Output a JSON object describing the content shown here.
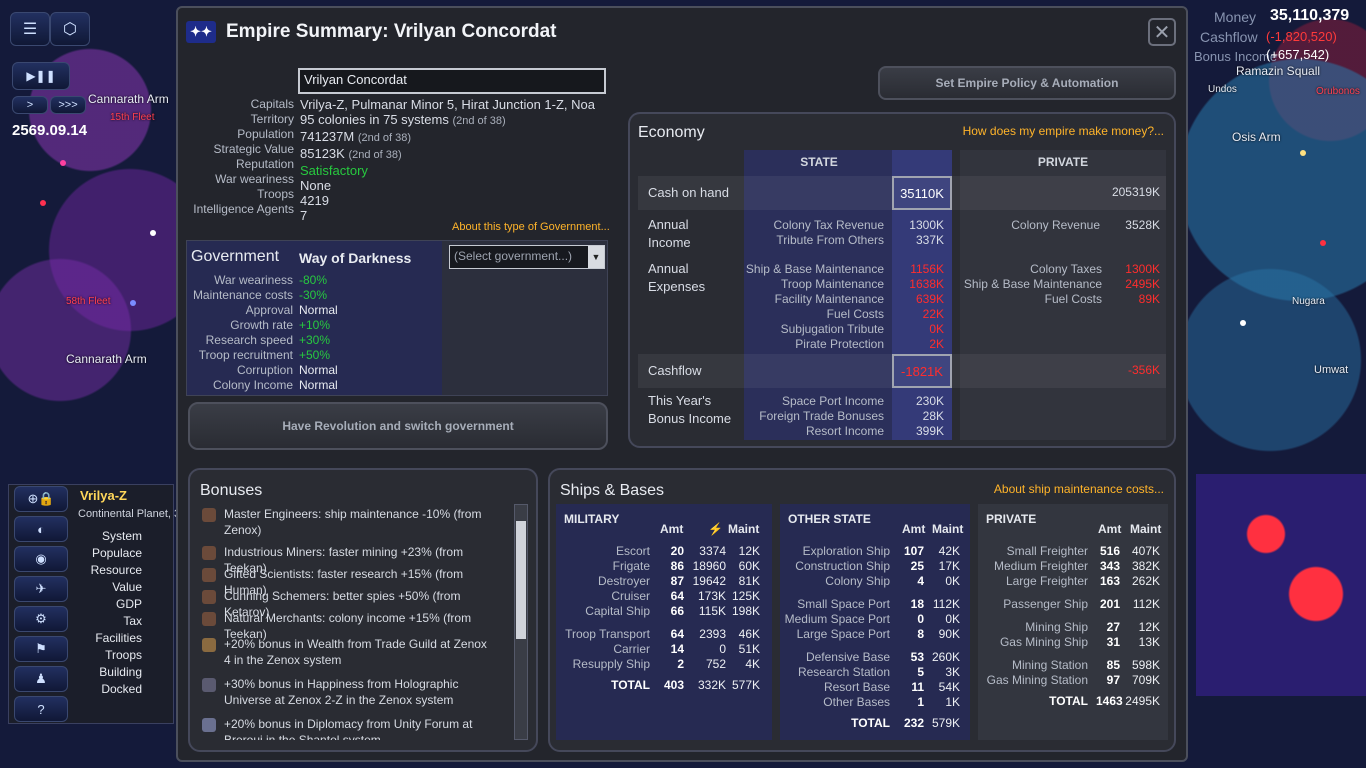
{
  "map": {
    "date": "2569.09.14",
    "labels_left": [
      "Cannarath Arm",
      "Cannarath Arm",
      "58th Fleet",
      "15th Fleet",
      "Vrilya-Z"
    ],
    "labels_right": [
      "Ramazin Squall",
      "Osis Arm",
      "Undos",
      "Umwat",
      "Nugara",
      "Orubonos"
    ],
    "money": {
      "label": "Money",
      "value": "35,110,379"
    },
    "cashflow": {
      "label": "Cashflow",
      "value": "(-1,820,520)"
    },
    "bonus_income": {
      "label": "Bonus Income",
      "value": "(+657,542)"
    }
  },
  "toolbar": {
    "play_label": "▶❚❚",
    "speed_slow": ">",
    "speed_fast": ">>>",
    "side_items": [
      "System",
      "Populace",
      "Resource",
      "Value",
      "GDP",
      "Tax",
      "Facilities",
      "Troops",
      "Building",
      "Docked"
    ],
    "selected_planet": "Vrilya-Z",
    "planet_desc": "Continental Planet, 3"
  },
  "window": {
    "title": "Empire Summary: Vrilyan Concordat",
    "close": "✕"
  },
  "empire": {
    "name_value": "Vrilyan Concordat",
    "rows": [
      {
        "label": "Capitals",
        "value": "Vrilya-Z, Pulmanar Minor 5, Hirat Junction 1-Z, Noa",
        "note": ""
      },
      {
        "label": "Territory",
        "value": "95 colonies in 75 systems",
        "note": "(2nd of 38)"
      },
      {
        "label": "Population",
        "value": "741237M",
        "note": "(2nd of 38)"
      },
      {
        "label": "Strategic Value",
        "value": "85123K",
        "note": "(2nd of 38)"
      },
      {
        "label": "Reputation",
        "value": "Satisfactory",
        "note": ""
      },
      {
        "label": "War weariness",
        "value": "None",
        "note": ""
      },
      {
        "label": "Troops",
        "value": "4219",
        "note": ""
      },
      {
        "label": "Intelligence Agents",
        "value": "7",
        "note": ""
      }
    ],
    "policy_button": "Set Empire Policy & Automation",
    "about_gov_link": "About this type of Government..."
  },
  "government": {
    "heading": "Government",
    "type": "Way of Darkness",
    "select_placeholder": "(Select government...)",
    "rows": [
      {
        "label": "War weariness",
        "value": "-80%",
        "color": "green"
      },
      {
        "label": "Maintenance costs",
        "value": "-30%",
        "color": "green"
      },
      {
        "label": "Approval",
        "value": "Normal",
        "color": "white"
      },
      {
        "label": "Growth rate",
        "value": "+10%",
        "color": "green"
      },
      {
        "label": "Research speed",
        "value": "+30%",
        "color": "green"
      },
      {
        "label": "Troop recruitment",
        "value": "+50%",
        "color": "green"
      },
      {
        "label": "Corruption",
        "value": "Normal",
        "color": "white"
      },
      {
        "label": "Colony Income",
        "value": "Normal",
        "color": "white"
      }
    ],
    "revolution_button": "Have Revolution and switch government"
  },
  "economy": {
    "heading": "Economy",
    "help_link": "How does my empire make money?...",
    "col_state": "STATE",
    "col_private": "PRIVATE",
    "cash_on_hand": {
      "label": "Cash on hand",
      "state": "35110K",
      "private": "205319K"
    },
    "annual_income": {
      "label": "Annual Income",
      "state_items": [
        {
          "label": "Colony Tax Revenue",
          "value": "1300K"
        },
        {
          "label": "Tribute From Others",
          "value": "337K"
        }
      ],
      "private_items": [
        {
          "label": "Colony Revenue",
          "value": "3528K"
        }
      ]
    },
    "annual_expenses": {
      "label": "Annual Expenses",
      "state_items": [
        {
          "label": "Ship & Base Maintenance",
          "value": "1156K"
        },
        {
          "label": "Troop Maintenance",
          "value": "1638K"
        },
        {
          "label": "Facility Maintenance",
          "value": "639K"
        },
        {
          "label": "Fuel Costs",
          "value": "22K"
        },
        {
          "label": "Subjugation Tribute",
          "value": "0K"
        },
        {
          "label": "Pirate Protection",
          "value": "2K"
        }
      ],
      "private_items": [
        {
          "label": "Colony Taxes",
          "value": "1300K"
        },
        {
          "label": "Ship & Base Maintenance",
          "value": "2495K"
        },
        {
          "label": "Fuel Costs",
          "value": "89K"
        }
      ]
    },
    "cashflow": {
      "label": "Cashflow",
      "state": "-1821K",
      "private": "-356K"
    },
    "bonus_income": {
      "label": "This Year's Bonus Income",
      "items": [
        {
          "label": "Space Port Income",
          "value": "230K"
        },
        {
          "label": "Foreign Trade Bonuses",
          "value": "28K"
        },
        {
          "label": "Resort Income",
          "value": "399K"
        }
      ]
    }
  },
  "bonuses": {
    "heading": "Bonuses",
    "items": [
      "Master Engineers: ship maintenance -10% (from Zenox)",
      "Industrious Miners: faster mining +23% (from Teekan)",
      "Gifted Scientists: faster research +15% (from Human)",
      "Cunning Schemers: better spies +50% (from Ketarov)",
      "Natural Merchants: colony income +15% (from Teekan)",
      "+20% bonus in Wealth from Trade Guild at Zenox 4 in the Zenox system",
      "+30% bonus in Happiness from Holographic Universe at Zenox 2-Z in the Zenox system",
      "+20% bonus in Diplomacy from Unity Forum at Breroui in the Shantol system"
    ]
  },
  "ships": {
    "heading": "Ships & Bases",
    "about_link": "About ship maintenance costs...",
    "military": {
      "heading": "MILITARY",
      "col_amt": "Amt",
      "col_maint": "Maint",
      "rows": [
        {
          "name": "Escort",
          "amt": "20",
          "str": "3374",
          "maint": "12K"
        },
        {
          "name": "Frigate",
          "amt": "86",
          "str": "18960",
          "maint": "60K"
        },
        {
          "name": "Destroyer",
          "amt": "87",
          "str": "19642",
          "maint": "81K"
        },
        {
          "name": "Cruiser",
          "amt": "64",
          "str": "173K",
          "maint": "125K"
        },
        {
          "name": "Capital Ship",
          "amt": "66",
          "str": "115K",
          "maint": "198K"
        },
        {
          "name": "Troop Transport",
          "amt": "64",
          "str": "2393",
          "maint": "46K"
        },
        {
          "name": "Carrier",
          "amt": "14",
          "str": "0",
          "maint": "51K"
        },
        {
          "name": "Resupply Ship",
          "amt": "2",
          "str": "752",
          "maint": "4K"
        }
      ],
      "total": {
        "name": "TOTAL",
        "amt": "403",
        "str": "332K",
        "maint": "577K"
      }
    },
    "other_state": {
      "heading": "OTHER STATE",
      "col_amt": "Amt",
      "col_maint": "Maint",
      "rows": [
        {
          "name": "Exploration Ship",
          "amt": "107",
          "maint": "42K"
        },
        {
          "name": "Construction Ship",
          "amt": "25",
          "maint": "17K"
        },
        {
          "name": "Colony Ship",
          "amt": "4",
          "maint": "0K"
        },
        {
          "name": "Small Space Port",
          "amt": "18",
          "maint": "112K"
        },
        {
          "name": "Medium Space Port",
          "amt": "0",
          "maint": "0K"
        },
        {
          "name": "Large Space Port",
          "amt": "8",
          "maint": "90K"
        },
        {
          "name": "Defensive Base",
          "amt": "53",
          "maint": "260K"
        },
        {
          "name": "Research Station",
          "amt": "5",
          "maint": "3K"
        },
        {
          "name": "Resort Base",
          "amt": "11",
          "maint": "54K"
        },
        {
          "name": "Other Bases",
          "amt": "1",
          "maint": "1K"
        }
      ],
      "total": {
        "name": "TOTAL",
        "amt": "232",
        "maint": "579K"
      }
    },
    "private": {
      "heading": "PRIVATE",
      "col_amt": "Amt",
      "col_maint": "Maint",
      "rows": [
        {
          "name": "Small Freighter",
          "amt": "516",
          "maint": "407K"
        },
        {
          "name": "Medium Freighter",
          "amt": "343",
          "maint": "382K"
        },
        {
          "name": "Large Freighter",
          "amt": "163",
          "maint": "262K"
        },
        {
          "name": "Passenger Ship",
          "amt": "201",
          "maint": "112K"
        },
        {
          "name": "Mining Ship",
          "amt": "27",
          "maint": "12K"
        },
        {
          "name": "Gas Mining Ship",
          "amt": "31",
          "maint": "13K"
        },
        {
          "name": "Mining Station",
          "amt": "85",
          "maint": "598K"
        },
        {
          "name": "Gas Mining Station",
          "amt": "97",
          "maint": "709K"
        }
      ],
      "total": {
        "name": "TOTAL",
        "amt": "1463",
        "maint": "2495K"
      }
    }
  }
}
